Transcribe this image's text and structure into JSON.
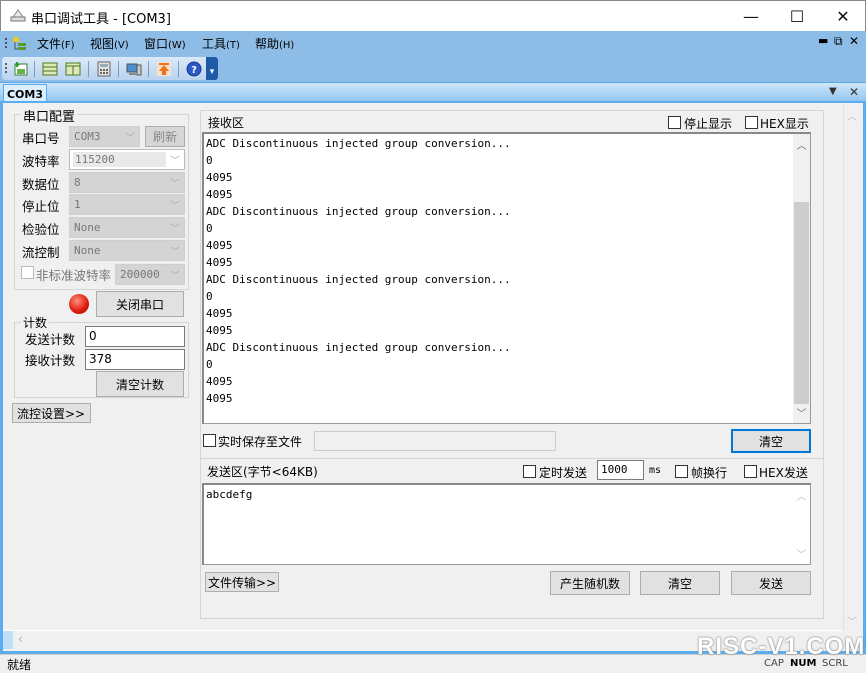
{
  "window": {
    "title": "串口调试工具 - [COM3]",
    "minimize": "—",
    "maximize": "☐",
    "close": "✕"
  },
  "menu": {
    "items": [
      {
        "label": "文件",
        "key": "(F)"
      },
      {
        "label": "视图",
        "key": "(V)"
      },
      {
        "label": "窗口",
        "key": "(W)"
      },
      {
        "label": "工具",
        "key": "(T)"
      },
      {
        "label": "帮助",
        "key": "(H)"
      }
    ],
    "mdi_min": "▬",
    "mdi_restore": "⧉",
    "mdi_close": "✕"
  },
  "toolbar": {
    "icons": [
      "new-icon",
      "layout-horizontal-icon",
      "layout-vertical-icon",
      "calculator-icon",
      "computer-icon",
      "upload-icon",
      "help-icon"
    ],
    "overflow": "▾"
  },
  "tab": {
    "label": "COM3",
    "dropdown": "▼",
    "close": "✕"
  },
  "serial_config": {
    "title": "串口配置",
    "port": {
      "label": "串口号",
      "value": "COM3",
      "refresh_label": "刷新"
    },
    "baud": {
      "label": "波特率",
      "value": "115200"
    },
    "databits": {
      "label": "数据位",
      "value": "8"
    },
    "stopbits": {
      "label": "停止位",
      "value": "1"
    },
    "parity": {
      "label": "检验位",
      "value": "None"
    },
    "flow": {
      "label": "流控制",
      "value": "None"
    },
    "custom_baud": {
      "label": "非标准波特率",
      "value": "200000",
      "checked": false
    },
    "status_color": "#e02010",
    "close_port_label": "关闭串口"
  },
  "counter": {
    "title": "计数",
    "send_label": "发送计数",
    "send_value": "0",
    "recv_label": "接收计数",
    "recv_value": "378",
    "clear_label": "清空计数"
  },
  "flow_settings_label": "流控设置>>",
  "receive": {
    "title": "接收区",
    "stop_display_label": "停止显示",
    "hex_display_label": "HEX显示",
    "lines": [
      "ADC Discontinuous injected group conversion...",
      "0",
      "4095",
      "4095",
      "ADC Discontinuous injected group conversion...",
      "0",
      "4095",
      "4095",
      "ADC Discontinuous injected group conversion...",
      "0",
      "4095",
      "4095",
      "ADC Discontinuous injected group conversion...",
      "0",
      "4095",
      "4095"
    ],
    "save_to_file_label": "实时保存至文件",
    "save_path": "",
    "clear_label": "清空"
  },
  "send": {
    "title": "发送区(字节<64KB)",
    "timed_send_label": "定时发送",
    "interval": "1000",
    "interval_unit": "ms",
    "newline_label": "帧换行",
    "hex_send_label": "HEX发送",
    "content": "abcdefg",
    "file_transfer_label": "文件传输>>",
    "random_label": "产生随机数",
    "clear_label": "清空",
    "send_label": "发送"
  },
  "statusbar": {
    "text": "就绪",
    "cap": "CAP",
    "num": "NUM",
    "scrl": "SCRL"
  },
  "watermark": "RISC-V1.COM"
}
